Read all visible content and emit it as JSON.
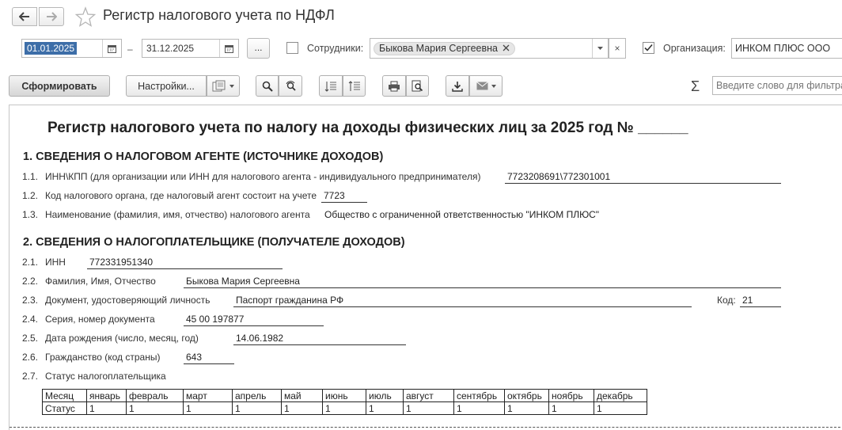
{
  "window": {
    "title": "Регистр налогового учета по НДФЛ"
  },
  "filters": {
    "date_from": "01.01.2025",
    "date_separator": "–",
    "date_to": "31.12.2025",
    "more_label": "...",
    "employees_label": "Сотрудники:",
    "employees_checked": false,
    "employee_value": "Быкова Мария Сергеевна",
    "clear_label": "×",
    "organization_label": "Организация:",
    "organization_checked": true,
    "organization_value": "ИНКОМ ПЛЮС ООО"
  },
  "toolbar": {
    "generate_label": "Сформировать",
    "settings_label": "Настройки...",
    "sigma": "Σ",
    "search_placeholder": "Введите слово для фильтра"
  },
  "report": {
    "title": "Регистр налогового учета по налогу на доходы физических лиц за 2025 год № ______",
    "section1": {
      "heading": "1. СВЕДЕНИЯ О НАЛОГОВОМ АГЕНТЕ (ИСТОЧНИКЕ ДОХОДОВ)",
      "rows": [
        {
          "num": "1.1.",
          "label": "ИНН\\КПП (для организации или ИНН для налогового агента -  индивидуального предпринимателя)",
          "value": "7723208691\\772301001"
        },
        {
          "num": "1.2.",
          "label": "Код налогового органа, где налоговый агент состоит на учете",
          "value": "7723"
        },
        {
          "num": "1.3.",
          "label": "Наименование (фамилия, имя, отчество) налогового агента",
          "value": "Общество с ограниченной ответственностью \"ИНКОМ ПЛЮС\""
        }
      ]
    },
    "section2": {
      "heading": "2. СВЕДЕНИЯ О НАЛОГОПЛАТЕЛЬЩИКЕ (ПОЛУЧАТЕЛЕ ДОХОДОВ)",
      "rows": [
        {
          "num": "2.1.",
          "label": "ИНН",
          "value": "772331951340"
        },
        {
          "num": "2.2.",
          "label": "Фамилия, Имя, Отчество",
          "value": "Быкова Мария Сергеевна"
        },
        {
          "num": "2.3.",
          "label": "Документ, удостоверяющий личность",
          "value": "Паспорт гражданина РФ",
          "code_label": "Код:",
          "code_value": "21"
        },
        {
          "num": "2.4.",
          "label": "Серия, номер документа",
          "value": "45 00 197877"
        },
        {
          "num": "2.5.",
          "label": "Дата рождения (число, месяц, год)",
          "value": "14.06.1982"
        },
        {
          "num": "2.6.",
          "label": "Гражданство (код страны)",
          "value": "643"
        },
        {
          "num": "2.7.",
          "label": "Статус налогоплательщика"
        }
      ]
    },
    "status_table": {
      "header": [
        "Месяц",
        "январь",
        "февраль",
        "март",
        "апрель",
        "май",
        "июнь",
        "июль",
        "август",
        "сентябрь",
        "октябрь",
        "ноябрь",
        "декабрь"
      ],
      "row": [
        "Статус",
        "1",
        "1",
        "1",
        "1",
        "1",
        "1",
        "1",
        "1",
        "1",
        "1",
        "1",
        "1"
      ]
    }
  }
}
